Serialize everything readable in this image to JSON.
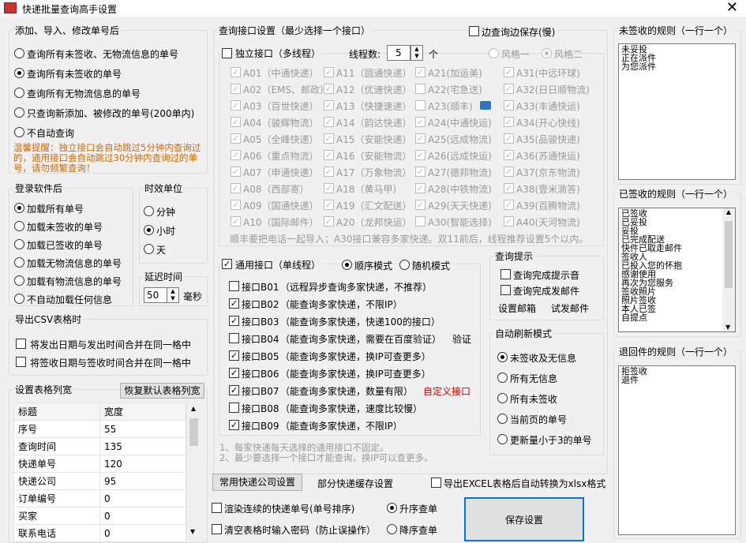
{
  "window": {
    "title": "快递批量查询高手设置",
    "close": "✕"
  },
  "add_group": {
    "legend": "添加、导入、修改单号后",
    "options": [
      "查询所有未签收、无物流信息的单号",
      "查询所有未签收的单号",
      "查询所有无物流信息的单号",
      "只查询新添加、被修改的单号(200单内)",
      "不自动查询"
    ],
    "selected": 1,
    "tip": "温馨提醒：独立接口会自动跳过5分钟内查询过的，通用接口会自动跳过30分钟内查询过的单号，请勿频繁查询！"
  },
  "login_group": {
    "legend": "登录软件后",
    "options": [
      "加载所有单号",
      "加载未签收的单号",
      "加载已签收的单号",
      "加载无物流信息的单号",
      "加载有物流信息的单号",
      "不自动加载任何信息"
    ],
    "selected": 0
  },
  "time_unit": {
    "legend": "时效单位",
    "options": [
      "分钟",
      "小时",
      "天"
    ],
    "selected": 1
  },
  "delay": {
    "legend": "延迟时间",
    "value": "50",
    "unit": "毫秒"
  },
  "csv": {
    "legend": "导出CSV表格时",
    "options": [
      "将发出日期与发出时间合并在同一格中",
      "将签收日期与签收时间合并在同一格中"
    ]
  },
  "colwidth": {
    "legend": "设置表格列宽",
    "reset": "恢复默认表格列宽",
    "headers": [
      "标题",
      "宽度"
    ],
    "rows": [
      [
        "序号",
        "55"
      ],
      [
        "查询时间",
        "135"
      ],
      [
        "快递单号",
        "120"
      ],
      [
        "快递公司",
        "95"
      ],
      [
        "订单编号",
        "0"
      ],
      [
        "买家",
        "0"
      ],
      [
        "联系电话",
        "0"
      ]
    ]
  },
  "api": {
    "legend": "查询接口设置（最少选择一个接口）",
    "save_while": "边查询边保存(慢)",
    "independent": "独立接口（多线程）",
    "threads_label": "线程数:",
    "threads": "5",
    "threads_unit": "个",
    "style1": "风格一",
    "style2": "风格二",
    "col1": [
      "A01（中通快递）",
      "A02（EMS、邮政）",
      "A03（百世快递）",
      "A04（骏辉物流）",
      "A05（全峰快递）",
      "A06（重点物流）",
      "A07（申通快递）",
      "A08（西部寄）",
      "A09（国通快递）",
      "A10（国际邮件）"
    ],
    "col2": [
      "A11（圆通快递）",
      "A12（优速快递）",
      "A13（快捷速递）",
      "A14（韵达快递）",
      "A15（安能快递）",
      "A16（安能物流）",
      "A17（万象物流）",
      "A18（黄马甲）",
      "A19（汇文配送）",
      "A20（龙邦快运）"
    ],
    "col3": [
      "A21(加运美)",
      "A22(宅急送)",
      "A23(顺丰)",
      "A24(中通快运)",
      "A25(远成物流)",
      "A26(远成快运)",
      "A27(德邦物流)",
      "A28(中铁物流)",
      "A29(天天快递)",
      "A30(智能选择)"
    ],
    "col4": [
      "A31(中远环球)",
      "A32(日日顺物流)",
      "A33(丰通快运)",
      "A34(开心快线)",
      "A35(品骏快递)",
      "A36(苏通快运)",
      "A37(京东物流)",
      "A38(壹米滴答)",
      "A39(百腾物流)",
      "A40(天河物流)"
    ],
    "note": "顺丰要把电话一起导入；A30接口兼容多家快递。双11前后，线程推荐设置5个以内。",
    "general": "通用接口（单线程）",
    "seq": "顺序模式",
    "rand": "随机模式",
    "b": [
      {
        "id": "接口B01",
        "desc": "（远程异步查询多家快递，不推荐）",
        "on": false
      },
      {
        "id": "接口B02",
        "desc": "（能查询多家快递，不限IP）",
        "on": true
      },
      {
        "id": "接口B03",
        "desc": "（能查询多家快递，快递100的接口）",
        "on": true
      },
      {
        "id": "接口B04",
        "desc": "（能查询多家快递，需要在百度验证）",
        "on": false
      },
      {
        "id": "接口B05",
        "desc": "（能查询多家快递，换IP可查更多）",
        "on": true
      },
      {
        "id": "接口B06",
        "desc": "（能查询多家快递，换IP可查更多）",
        "on": true
      },
      {
        "id": "接口B07",
        "desc": "（能查询多家快递，数量有限）",
        "on": true
      },
      {
        "id": "接口B08",
        "desc": "（能查询多家快递，速度比较慢）",
        "on": false
      },
      {
        "id": "接口B09",
        "desc": "（能查询多家快递，不限IP）",
        "on": true
      }
    ],
    "verify": "验证",
    "custom": "自定义接口",
    "note2": "1、每家快递每天选择的通用接口不固定。",
    "note3": "2、最少要选择一个接口才能查询，换IP可以查更多。"
  },
  "prompt": {
    "legend": "查询提示",
    "opt1": "查询完成提示音",
    "opt2": "查询完成发邮件",
    "mailbox": "设置邮箱",
    "testmail": "试发邮件"
  },
  "refresh": {
    "legend": "自动刷新模式",
    "options": [
      "未签收及无信息",
      "所有无信息",
      "所有未签收",
      "当前页的单号",
      "更新量小于3的单号"
    ],
    "selected": 0
  },
  "bottom": {
    "common": "常用快递公司设置",
    "cache": "部分快递缓存设置",
    "excel": "导出EXCEL表格后自动转换为xlsx格式",
    "render": "渲染连续的快递单号(单号排序)",
    "asc": "升序查单",
    "clear": "清空表格时输入密码（防止误操作）",
    "desc": "降序查单",
    "save": "保存设置"
  },
  "rules": {
    "unsigned_legend": "未签收的规则（一行一个）",
    "unsigned": "未妥投\n正在派件\n为您派件",
    "signed_legend": "已签收的规则（一行一个）",
    "signed": "已签收\n已妥投\n妥投\n已完成配送\n快件已取走邮件\n签收人\n已投入您的怀抱\n感谢使用\n再次为您服务\n签收照片\n照片签收\n本人已签\n自提点",
    "returned_legend": "退回件的规则（一行一个）",
    "returned": "拒签收\n退件"
  }
}
